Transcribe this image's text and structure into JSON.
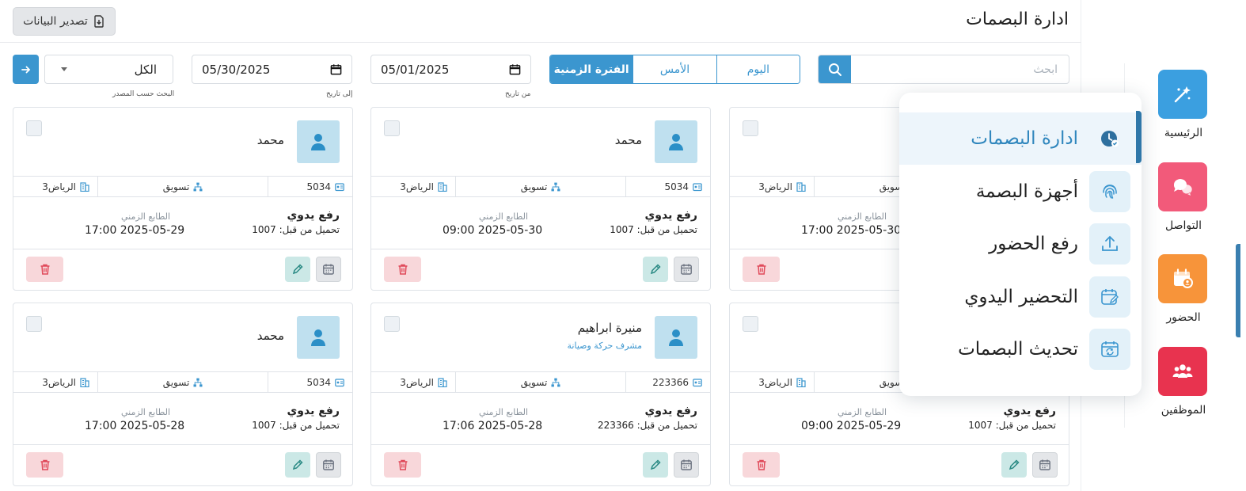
{
  "header": {
    "title": "ادارة البصمات",
    "export_label": "تصدير البيانات"
  },
  "filters": {
    "search_placeholder": "ابحث",
    "period_today": "اليوم",
    "period_yesterday": "الأمس",
    "period_range": "الفترة الزمنية",
    "date_from": "05/01/2025",
    "date_from_label": "من تاريخ",
    "date_to": "05/30/2025",
    "date_to_label": "إلى تاريخ",
    "source_value": "الكل",
    "source_label": "البحث حسب المصدر"
  },
  "common": {
    "department": "تسويق",
    "branch": "الرياض3",
    "upload_type": "رفع يدوي",
    "timestamp_label": "الطابع الزمني"
  },
  "cards": [
    {
      "name": "محمد",
      "code": "5034",
      "upload_by": "تحميل من قبل: 1007",
      "timestamp": "17:00 2025-05-29"
    },
    {
      "name": "محمد",
      "code": "5034",
      "upload_by": "تحميل من قبل: 1007",
      "timestamp": "09:00 2025-05-30"
    },
    {
      "name": "",
      "code": "",
      "upload_by": "",
      "timestamp": "17:00 2025-05-30"
    },
    {
      "name": "محمد",
      "code": "5034",
      "upload_by": "تحميل من قبل: 1007",
      "timestamp": "17:00 2025-05-28"
    },
    {
      "name": "منيرة ابراهيم",
      "role": "مشرف حركة وصيانة",
      "code": "223366",
      "upload_by": "تحميل من قبل: 223366",
      "timestamp": "17:06 2025-05-28"
    },
    {
      "name": "",
      "code": "",
      "upload_by": "تحميل من قبل: 1007",
      "timestamp": "09:00 2025-05-29"
    }
  ],
  "sidebar": {
    "items": [
      {
        "label": "الرئيسية",
        "color": "#3b9fe0"
      },
      {
        "label": "التواصل",
        "color": "#f25a7a"
      },
      {
        "label": "الحضور",
        "color": "#f7943a"
      },
      {
        "label": "الموظفين",
        "color": "#e8334f"
      }
    ]
  },
  "menu": {
    "items": [
      {
        "label": "ادارة البصمات"
      },
      {
        "label": "أجهزة البصمة"
      },
      {
        "label": "رفع الحضور"
      },
      {
        "label": "التحضير اليدوي"
      },
      {
        "label": "تحديث البصمات"
      }
    ]
  },
  "colors": {
    "accent": "#3b96cf",
    "delete_bg": "#f8d7da",
    "edit_bg": "#cbe8e6"
  }
}
